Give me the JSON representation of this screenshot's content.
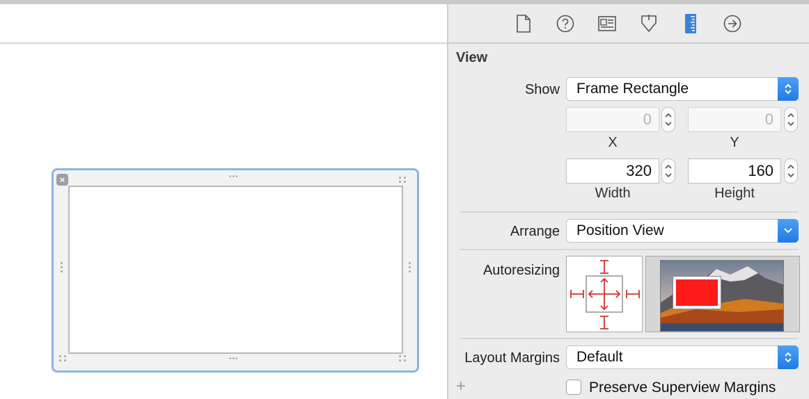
{
  "inspector": {
    "tabs": [
      {
        "icon": "file-icon",
        "active": false
      },
      {
        "icon": "help-icon",
        "active": false
      },
      {
        "icon": "identity-icon",
        "active": false
      },
      {
        "icon": "attributes-icon",
        "active": false
      },
      {
        "icon": "size-ruler-icon",
        "active": true
      },
      {
        "icon": "connections-arrow-icon",
        "active": false
      }
    ],
    "section_title": "View",
    "show": {
      "label": "Show",
      "value": "Frame Rectangle"
    },
    "x": {
      "value": "0",
      "label": "X"
    },
    "y": {
      "value": "0",
      "label": "Y"
    },
    "width": {
      "value": "320",
      "label": "Width"
    },
    "height": {
      "value": "160",
      "label": "Height"
    },
    "arrange": {
      "label": "Arrange",
      "value": "Position View"
    },
    "autoresizing": {
      "label": "Autoresizing",
      "preview_color": "#ff1a1a"
    },
    "layout_margins": {
      "label": "Layout Margins",
      "value": "Default"
    },
    "add_symbol": "+",
    "preserve_superview_margins": {
      "label": "Preserve Superview Margins",
      "checked": false
    }
  },
  "colors": {
    "accent": "#1f7ae6",
    "selection_border": "#8fb5e2",
    "autoresize_red": "#d0342c",
    "active_tab": "#3b82d6"
  }
}
